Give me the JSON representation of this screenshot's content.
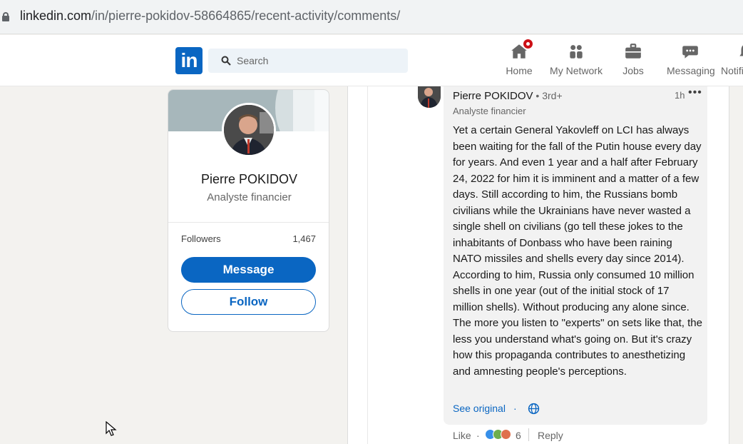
{
  "browser": {
    "url_host": "linkedin.com",
    "url_path": "/in/pierre-pokidov-58664865/recent-activity/comments/"
  },
  "nav": {
    "logo": "in",
    "search_placeholder": "Search",
    "items": [
      {
        "label": "Home",
        "icon": "home-icon"
      },
      {
        "label": "My Network",
        "icon": "network-icon"
      },
      {
        "label": "Jobs",
        "icon": "briefcase-icon"
      },
      {
        "label": "Messaging",
        "icon": "messaging-icon"
      },
      {
        "label": "Notifi",
        "icon": "bell-icon"
      }
    ]
  },
  "profile": {
    "name": "Pierre POKIDOV",
    "title": "Analyste financier",
    "followers_label": "Followers",
    "followers_count": "1,467",
    "message_button": "Message",
    "follow_button": "Follow"
  },
  "comment": {
    "author": "Pierre POKIDOV",
    "degree": " • 3rd+",
    "author_title": "Analyste financier",
    "time": "1h",
    "more": "•••",
    "text": "Yet a certain General Yakovleff on LCI has always been waiting for the fall of the Putin house every day for years. And even 1 year and a half after February 24, 2022 for him it is imminent and a matter of a few days. Still according to him, the Russians bomb civilians while the Ukrainians have never wasted a single shell on civilians (go tell these jokes to the inhabitants of Donbass who have been raining NATO missiles and shells every day since 2014). According to him, Russia only consumed 10 million shells in one year (out of the initial stock of 17 million shells). Without producing any alone since. The more you listen to \"experts\" on sets like that, the less you understand what's going on. But it's crazy how this propaganda contributes to anesthetizing and amnesting people's perceptions.",
    "see_original": "See original",
    "dot": "·",
    "like": "Like",
    "dot2": "·",
    "reaction_count": "6",
    "reply": "Reply"
  },
  "colors": {
    "brand": "#0a66c2",
    "badge": "#cc1016",
    "background": "#f3f2ef"
  }
}
